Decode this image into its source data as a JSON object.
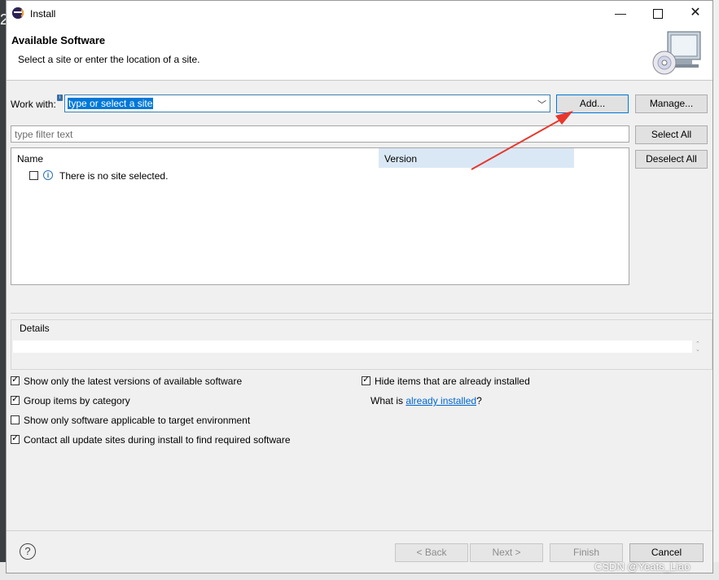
{
  "background": {
    "editor_digit": "2"
  },
  "window": {
    "title": "Install",
    "min_glyph": "—",
    "close_glyph": "✕"
  },
  "header": {
    "title": "Available Software",
    "subtitle": "Select a site or enter the location of a site."
  },
  "work_with": {
    "label": "Work with:",
    "value": "type or select a site",
    "add_label": "Add...",
    "manage_label": "Manage..."
  },
  "filter": {
    "placeholder": "type filter text"
  },
  "side_buttons": {
    "select_all": "Select All",
    "deselect_all": "Deselect All"
  },
  "tree": {
    "columns": {
      "name": "Name",
      "version": "Version"
    },
    "rows": [
      {
        "text": "There is no site selected.",
        "checked": false
      }
    ]
  },
  "details": {
    "label": "Details"
  },
  "options": {
    "latest_versions": {
      "label": "Show only the latest versions of available software",
      "checked": true
    },
    "group_by_category": {
      "label": "Group items by category",
      "checked": true
    },
    "target_env": {
      "label": "Show only software applicable to target environment",
      "checked": false
    },
    "contact_sites": {
      "label": "Contact all update sites during install to find required software",
      "checked": true
    },
    "hide_installed": {
      "label": "Hide items that are already installed",
      "checked": true
    },
    "what_is": {
      "prefix": "What is ",
      "link": "already installed",
      "suffix": "?"
    }
  },
  "footer": {
    "help_glyph": "?",
    "back": "< Back",
    "next": "Next >",
    "finish": "Finish",
    "cancel": "Cancel"
  },
  "watermark": "CSDN @Yeats_Liao",
  "colors": {
    "accent": "#0078d7",
    "arrow": "#e8372c",
    "version_header": "#dae8f5"
  }
}
